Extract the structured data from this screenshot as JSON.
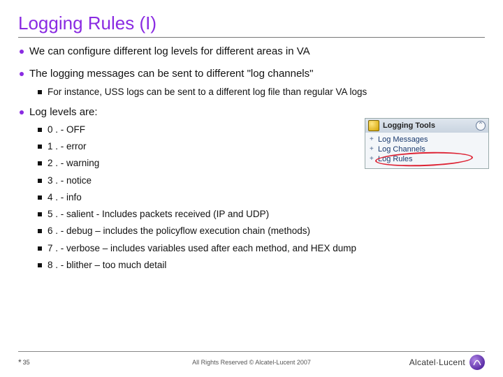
{
  "title": "Logging Rules (I)",
  "bullets": {
    "b1": "We can configure different log levels for different areas in VA",
    "b2": "The logging messages can be sent to different \"log channels\"",
    "b2_sub": "For instance, USS logs can be sent to a different log file than regular VA logs",
    "b3": "Log levels are:"
  },
  "levels": [
    "0 . - OFF",
    "1 . - error",
    "2 . - warning",
    "3 . - notice",
    "4 . - info",
    "5 . - salient - Includes packets received (IP and UDP)",
    "6 . - debug – includes the policyflow execution chain (methods)",
    "7 . - verbose – includes variables used after each method, and HEX dump",
    "8 . - blither – too much detail"
  ],
  "panel": {
    "header": "Logging Tools",
    "items": [
      "Log Messages",
      "Log Channels",
      "Log Rules"
    ]
  },
  "footer": {
    "page": "35",
    "copyright": "All Rights Reserved © Alcatel-Lucent 2007",
    "brand": "Alcatel·Lucent"
  }
}
